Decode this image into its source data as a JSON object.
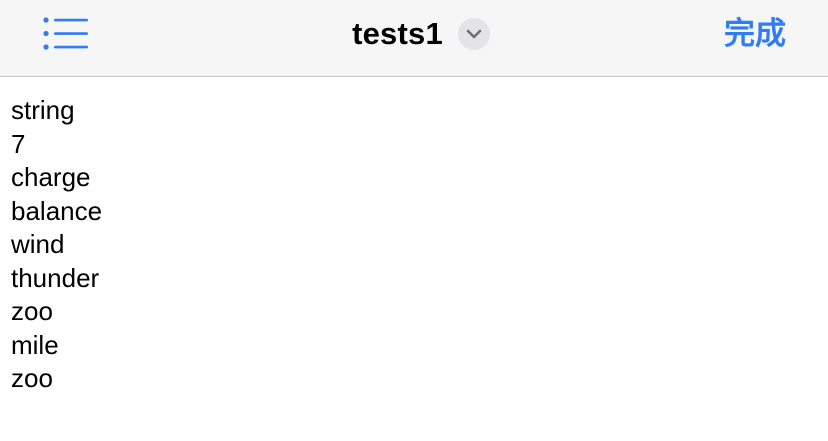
{
  "nav": {
    "title": "tests1",
    "done_label": "完成",
    "accent_color": "#2f7cf6",
    "left_icon": "list-icon",
    "title_icon": "chevron-down-icon"
  },
  "editor": {
    "lines": [
      "string",
      "7",
      "charge",
      "balance",
      "wind",
      "thunder",
      "zoo",
      "mile",
      "zoo"
    ]
  }
}
